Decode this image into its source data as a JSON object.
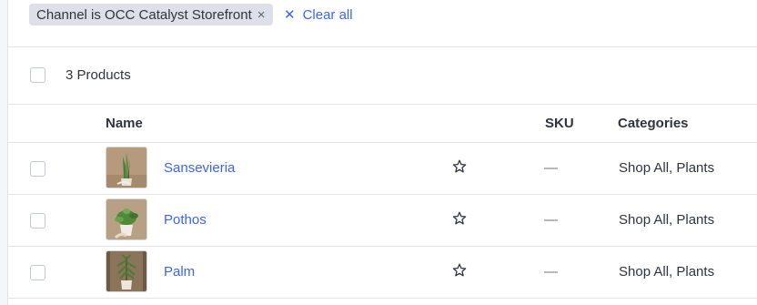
{
  "filters": {
    "active_chip": {
      "label": "Channel is OCC Catalyst Storefront",
      "close_glyph": "×"
    },
    "clear_all": {
      "glyph": "✕",
      "label": "Clear all"
    }
  },
  "summary": {
    "count_label": "3 Products"
  },
  "table": {
    "columns": {
      "name": "Name",
      "sku": "SKU",
      "categories": "Categories"
    },
    "rows": [
      {
        "name": "Sansevieria",
        "sku": "—",
        "categories": "Shop All, Plants",
        "thumbnail_icon": "snake-plant-thumbnail",
        "favorite_icon": "star-outline-icon"
      },
      {
        "name": "Pothos",
        "sku": "—",
        "categories": "Shop All, Plants",
        "thumbnail_icon": "pothos-plant-thumbnail",
        "favorite_icon": "star-outline-icon"
      },
      {
        "name": "Palm",
        "sku": "—",
        "categories": "Shop All, Plants",
        "thumbnail_icon": "palm-plant-thumbnail",
        "favorite_icon": "star-outline-icon"
      }
    ]
  },
  "colors": {
    "link": "#3c64f4",
    "chip_bg": "#dde0e8",
    "border": "#e2e4e9",
    "text": "#313440"
  }
}
